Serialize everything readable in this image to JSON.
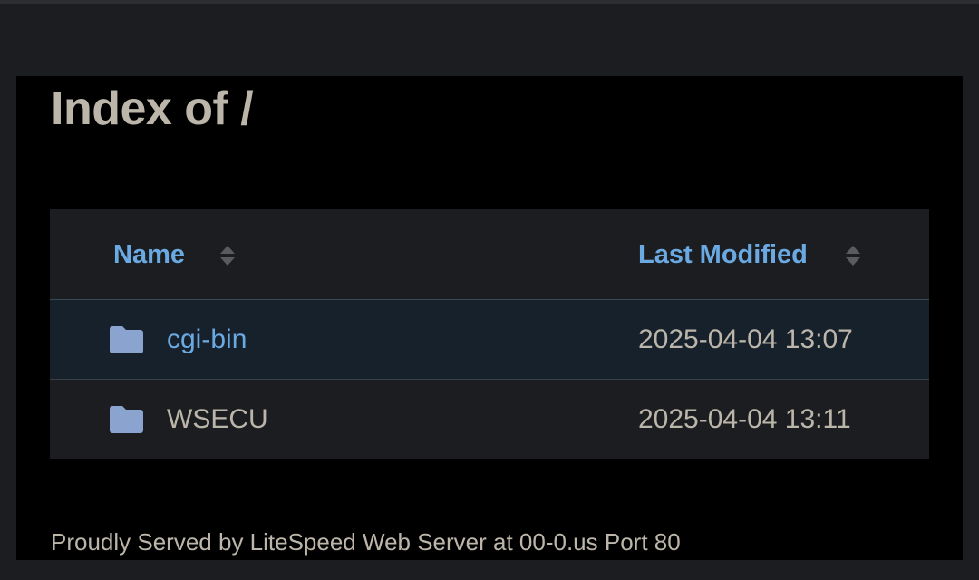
{
  "page": {
    "title": "Index of /"
  },
  "table": {
    "columns": [
      {
        "label": "Name"
      },
      {
        "label": "Last Modified"
      }
    ],
    "rows": [
      {
        "name": "cgi-bin",
        "modified": "2025-04-04 13:07",
        "link_color": "#6aa9e2",
        "highlighted": true
      },
      {
        "name": "WSECU",
        "modified": "2025-04-04 13:11",
        "link_color": "#bcb6aa",
        "highlighted": false
      }
    ]
  },
  "footer": {
    "text": "Proudly Served by LiteSpeed Web Server at 00-0.us Port 80"
  },
  "icons": {
    "folder": "folder-icon",
    "sort": "sort-updown-icon"
  },
  "colors": {
    "link": "#6aa9e2",
    "text": "#bcb6aa",
    "folder": "#8aa3cf",
    "background": "#000000"
  }
}
